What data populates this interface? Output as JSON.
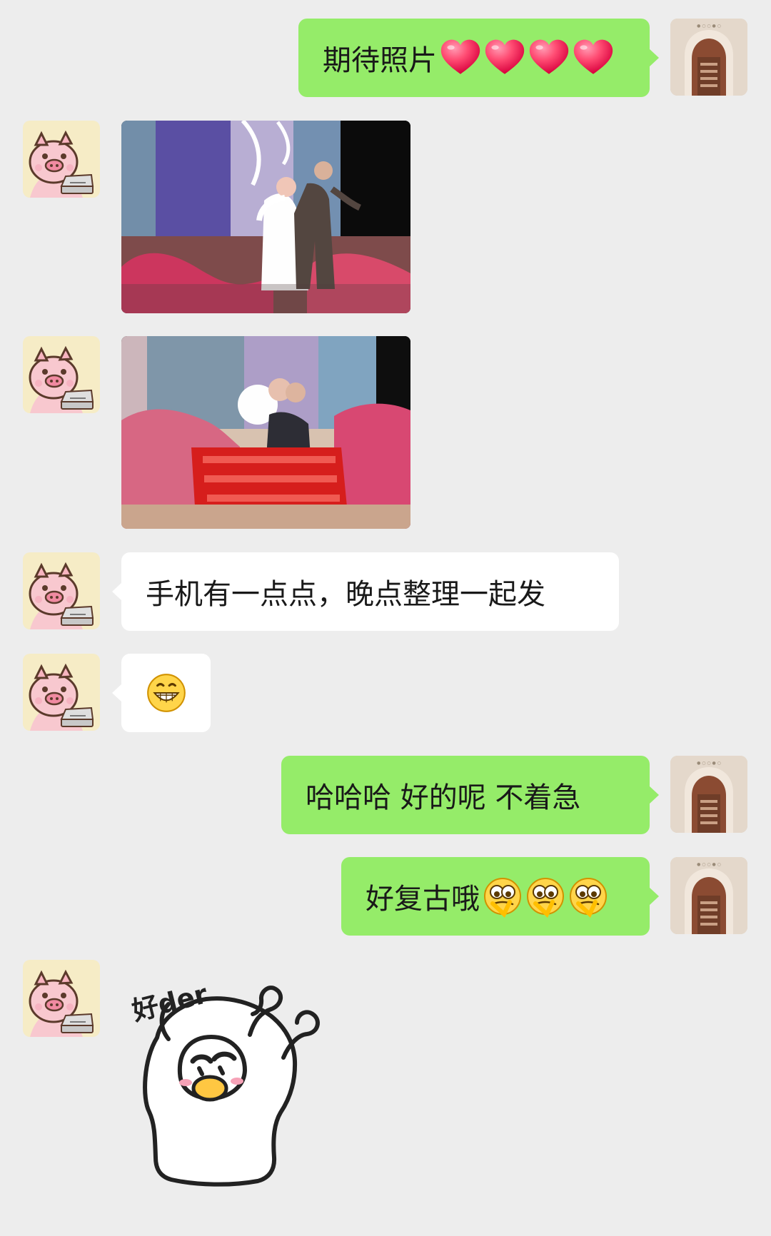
{
  "conversation": {
    "messages": [
      {
        "sender": "me",
        "text": "期待照片",
        "emoji": "red-heart ×4"
      },
      {
        "sender": "them",
        "type": "image",
        "content": "wedding-photo-1"
      },
      {
        "sender": "them",
        "type": "image",
        "content": "wedding-photo-2"
      },
      {
        "sender": "them",
        "text": "手机有一点点，晚点整理一起发"
      },
      {
        "sender": "them",
        "type": "emoji",
        "content": "grin-face"
      },
      {
        "sender": "me",
        "text": "哈哈哈 好的呢 不着急"
      },
      {
        "sender": "me",
        "text": "好复古哦",
        "emoji": "thinking-face ×3"
      },
      {
        "sender": "them",
        "type": "sticker",
        "content": "duck-sticker",
        "sticker_text": "好der"
      }
    ]
  },
  "icons": {
    "heart": "red-heart-icon",
    "grin": "grin-face-icon",
    "thinking": "thinking-face-icon",
    "me_avatar": "arch-building-avatar",
    "them_avatar": "pig-laptop-avatar"
  },
  "colors": {
    "background": "#ededed",
    "me_bubble": "#95ec69",
    "them_bubble": "#ffffff",
    "text": "#191919"
  }
}
